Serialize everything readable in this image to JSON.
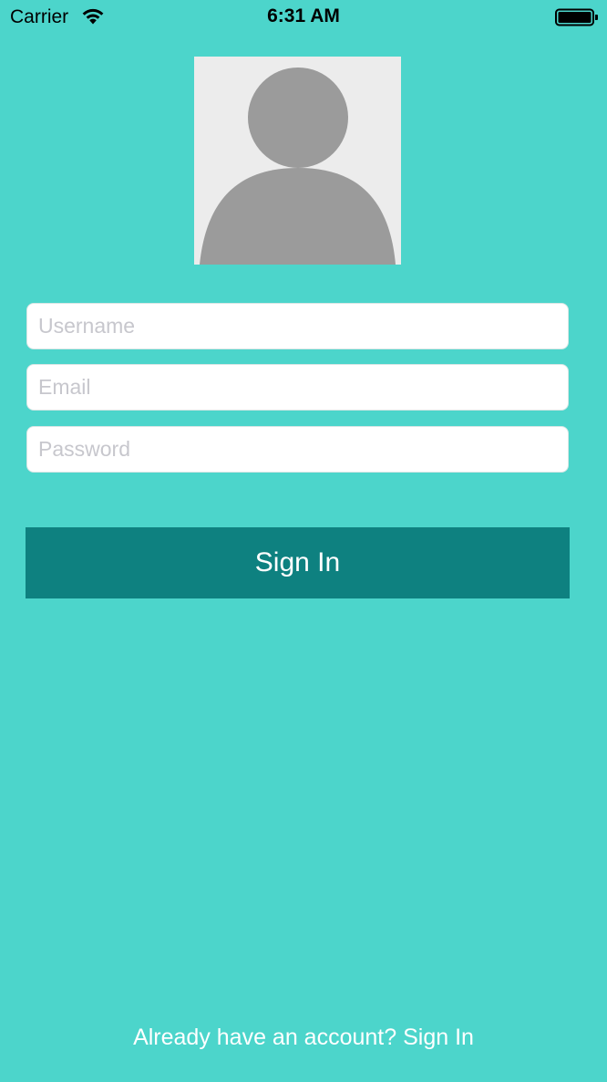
{
  "status_bar": {
    "carrier": "Carrier",
    "time": "6:31 AM",
    "wifi_icon": "wifi-icon",
    "battery_icon": "battery-icon"
  },
  "avatar": {
    "icon": "user-placeholder-icon"
  },
  "form": {
    "username_placeholder": "Username",
    "email_placeholder": "Email",
    "password_placeholder": "Password",
    "username_value": "",
    "email_value": "",
    "password_value": ""
  },
  "actions": {
    "signin_label": "Sign In"
  },
  "footer": {
    "link_text": "Already have an account? Sign In"
  },
  "colors": {
    "background": "#4cd5cb",
    "button": "#0e8180",
    "avatar_bg": "#ececec",
    "avatar_fg": "#9b9b9b"
  }
}
